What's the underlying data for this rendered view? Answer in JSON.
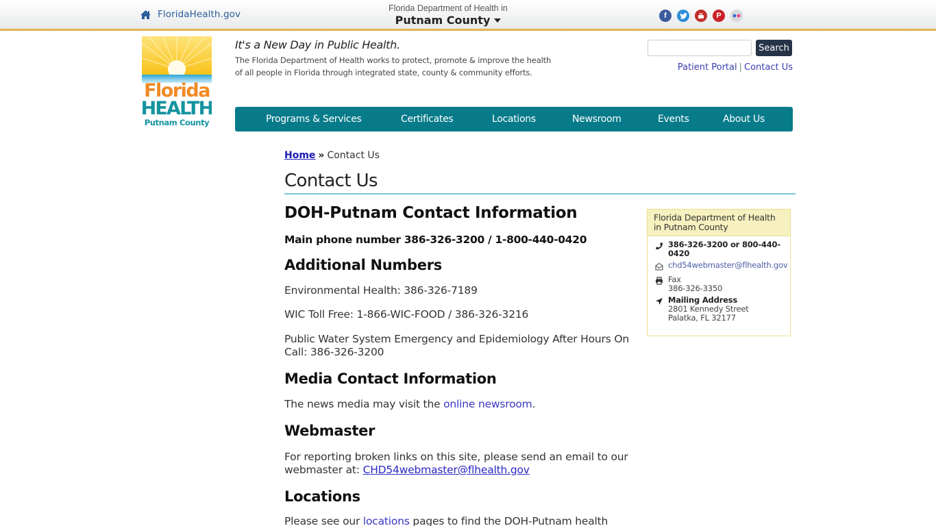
{
  "topbar": {
    "home_link": "FloridaHealth.gov",
    "county_prefix": "Florida Department of Health in",
    "county_name": "Putnam County",
    "social_icons": [
      "facebook-icon",
      "twitter-icon",
      "youtube-icon",
      "pinterest-icon",
      "flickr-icon"
    ]
  },
  "logo": {
    "word1": "Florida",
    "word2": "HEALTH",
    "county": "Putnam County"
  },
  "tagline": {
    "headline": "It's a New Day in Public Health.",
    "description": "The Florida Department of Health works to protect, promote & improve the health of all people in Florida through integrated state, county & community efforts."
  },
  "search": {
    "placeholder": "",
    "value": "",
    "button_label": "Search"
  },
  "quick_links": {
    "patient_portal": "Patient Portal",
    "separator": "|",
    "contact_us": "Contact Us"
  },
  "nav": {
    "items": [
      {
        "label": "Programs & Services"
      },
      {
        "label": "Certificates"
      },
      {
        "label": "Locations"
      },
      {
        "label": "Newsroom"
      },
      {
        "label": "Events"
      },
      {
        "label": "About Us"
      }
    ]
  },
  "breadcrumb": {
    "home": "Home",
    "separator": "»",
    "current": "Contact Us"
  },
  "page_title": "Contact Us",
  "content": {
    "heading_main": "DOH-Putnam Contact Information",
    "main_phone": "Main phone number 386-326-3200 / 1-800-440-0420",
    "heading_additional": "Additional Numbers",
    "environmental": "Environmental Health: 386-326-7189",
    "wic": "WIC Toll Free: 1-866-WIC-FOOD / 386-326-3216",
    "water": "Public Water System Emergency and Epidemiology After Hours On Call: 386-326-3200",
    "heading_media": "Media Contact Information",
    "media_text_before": "The news media may visit the ",
    "media_link": "online newsroom",
    "media_text_after": ".",
    "heading_webmaster": "Webmaster",
    "webmaster_text": "For reporting broken links on this site, please send an email to our webmaster at: ",
    "webmaster_email": "CHD54webmaster@flhealth.gov",
    "heading_locations": "Locations",
    "locations_before": "Please see our ",
    "locations_link": "locations",
    "locations_after": " pages to find the DOH-Putnam health"
  },
  "contact_box": {
    "title": "Florida Department of Health in Putnam County",
    "phone": "386-326-3200 or 800-440-0420",
    "email": "chd54webmaster@flhealth.gov",
    "fax_label": "Fax",
    "fax_number": "386-326-3350",
    "address_label": "Mailing Address",
    "address_line1": "2801 Kennedy Street",
    "address_line2": "Palatka, FL 32177"
  },
  "colors": {
    "nav_bg": "#077b8a",
    "top_border": "#e2b44f",
    "search_button": "#253447",
    "title_underline": "#7cc4d5",
    "contact_box_header": "#f6f1bf",
    "link": "#3a36c4"
  }
}
